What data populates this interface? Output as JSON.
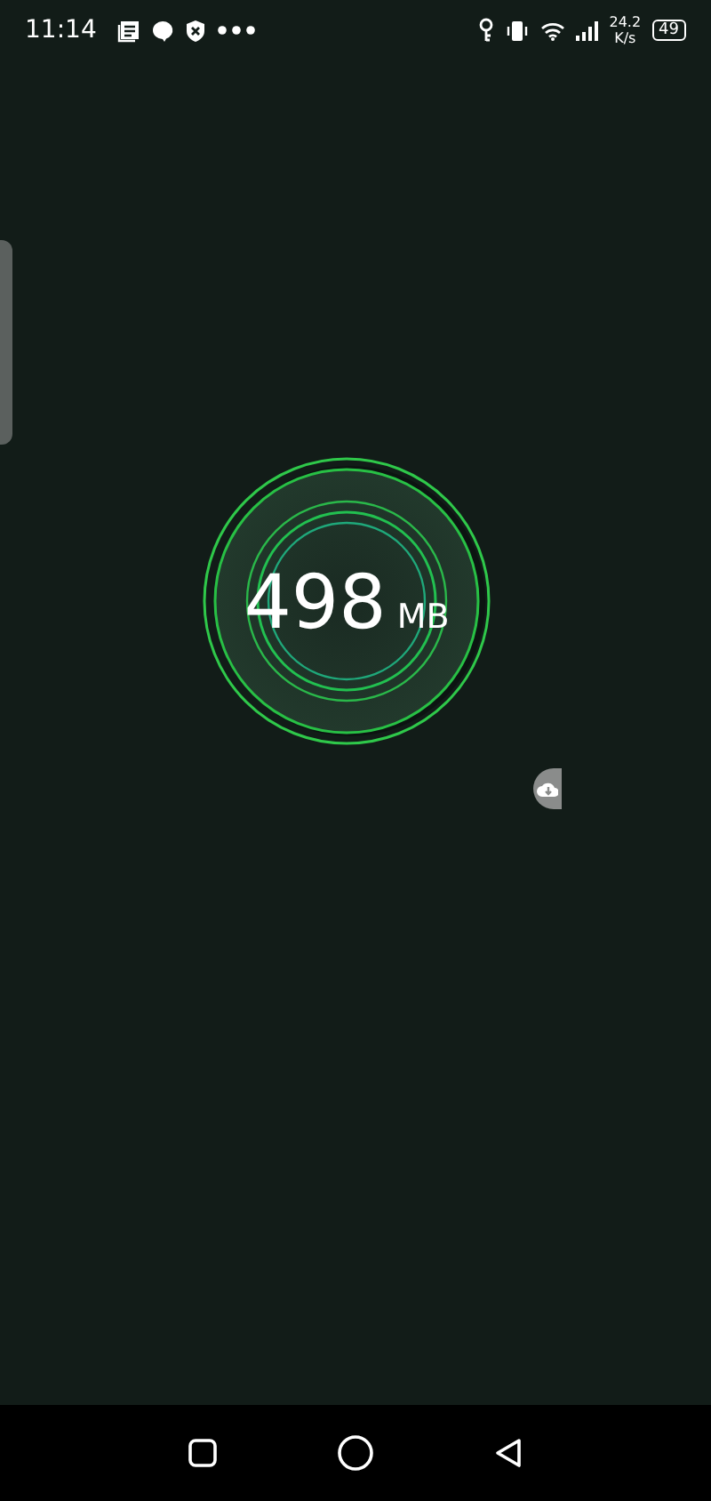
{
  "status_bar": {
    "time": "11:14",
    "speed_value": "24.2",
    "speed_unit": "K/s",
    "battery": "49"
  },
  "usage": {
    "value": "498",
    "unit": "MB"
  }
}
